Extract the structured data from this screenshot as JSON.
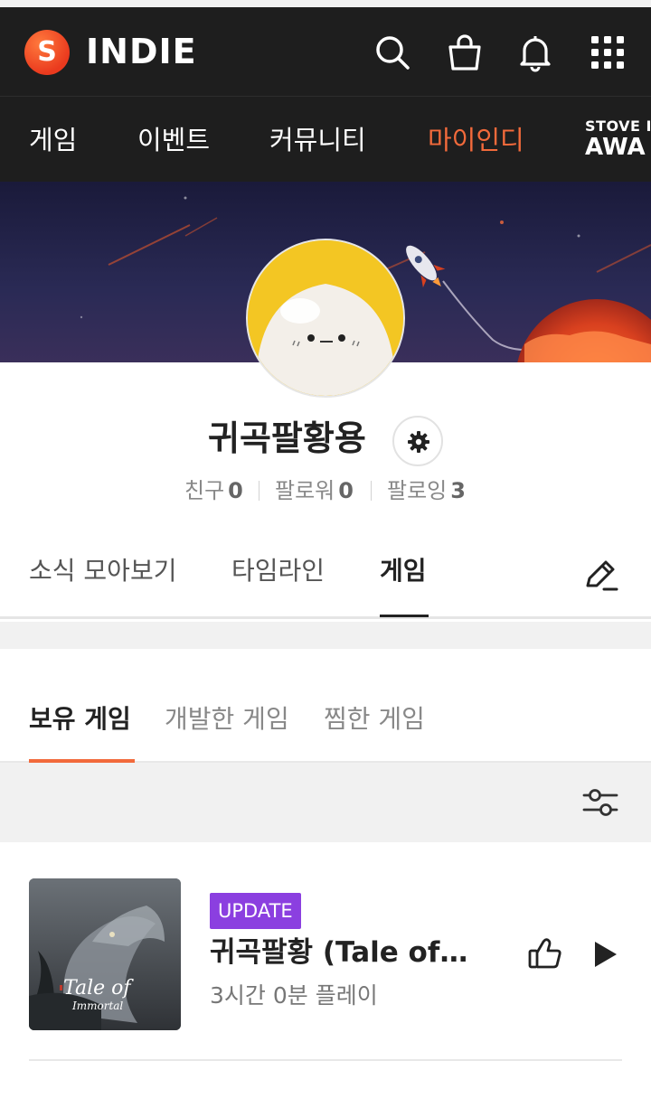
{
  "header": {
    "logo_letter": "S",
    "logo_text": "INDIE",
    "icons": [
      "search-icon",
      "shopping-bag-icon",
      "bell-icon",
      "grid-menu-icon"
    ]
  },
  "nav": {
    "items": [
      {
        "label": "게임"
      },
      {
        "label": "이벤트"
      },
      {
        "label": "커뮤니티"
      },
      {
        "label": "마이인디",
        "active": true
      }
    ],
    "awards_line1": "STOVE I",
    "awards_line2": "AWA"
  },
  "profile": {
    "name": "귀곡팔황용",
    "stats": [
      {
        "label": "친구",
        "value": "0"
      },
      {
        "label": "팔로워",
        "value": "0"
      },
      {
        "label": "팔로잉",
        "value": "3"
      }
    ]
  },
  "profile_tabs": {
    "items": [
      {
        "label": "소식 모아보기"
      },
      {
        "label": "타임라인"
      },
      {
        "label": "게임",
        "active": true
      }
    ]
  },
  "game_tabs": {
    "items": [
      {
        "label": "보유 게임",
        "active": true
      },
      {
        "label": "개발한 게임"
      },
      {
        "label": "찜한 게임"
      }
    ]
  },
  "games": [
    {
      "badge": "UPDATE",
      "title": "귀곡팔황 (Tale of Immortal)",
      "playtime": "3시간 0분 플레이",
      "thumb_text_line1": "Tale of",
      "thumb_text_line2": "Immortal"
    }
  ],
  "colors": {
    "accent": "#f26a3b",
    "header_bg": "#1e1e1e",
    "badge_bg": "#8b3fe0"
  }
}
